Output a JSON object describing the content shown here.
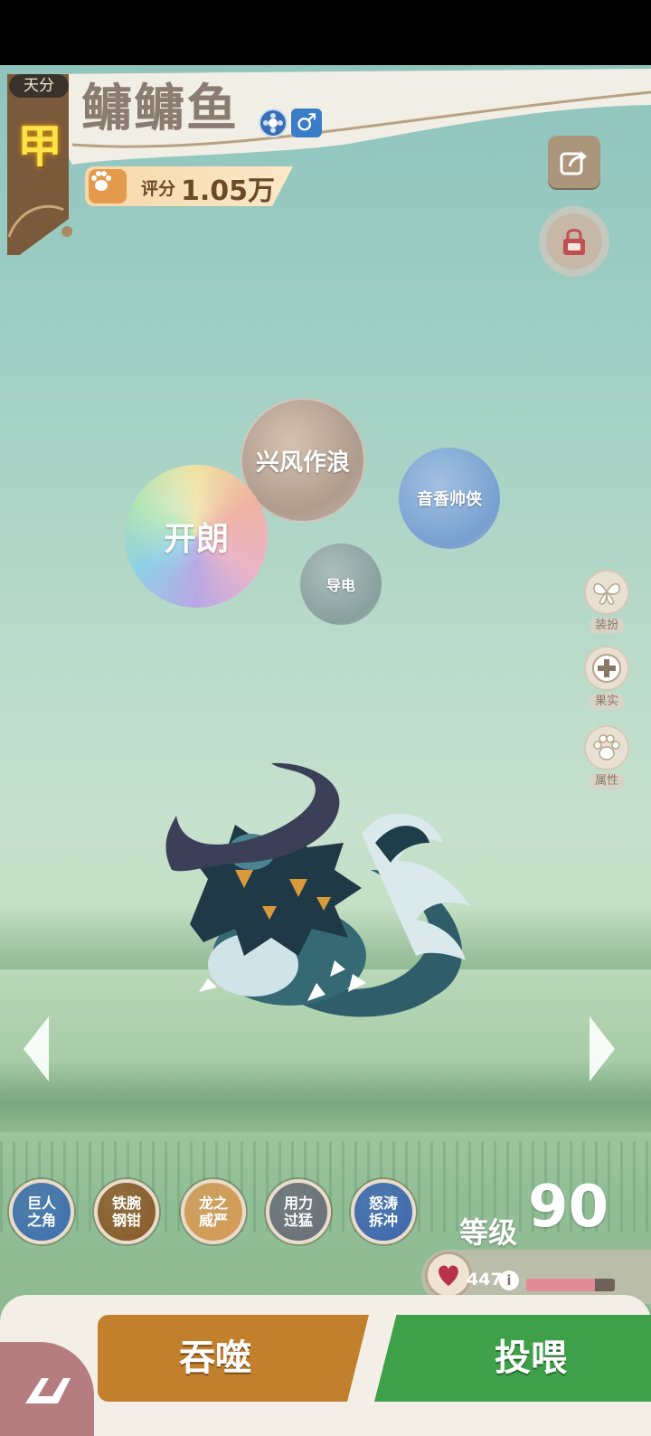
{
  "header": {
    "talent_label": "天分",
    "talent_grade": "甲",
    "pet_name": "鳙鳙鱼",
    "gender_symbol": "♂",
    "score_label": "评分",
    "score_value": "1.05万"
  },
  "top_actions": {
    "share_icon": "share-icon",
    "lock_icon": "lock-icon"
  },
  "traits": [
    {
      "label": "兴风作浪"
    },
    {
      "label": "开朗"
    },
    {
      "label": "音香帅侠"
    },
    {
      "label": "导电"
    }
  ],
  "side_menu": [
    {
      "label": "装扮",
      "icon": "butterfly-icon"
    },
    {
      "label": "果实",
      "icon": "plus-icon"
    },
    {
      "label": "属性",
      "icon": "paw-icon"
    }
  ],
  "skills": [
    {
      "label": "巨人之角",
      "color": "#3f6fae"
    },
    {
      "label": "铁腕钢钳",
      "color": "#8c5a2a"
    },
    {
      "label": "龙之威严",
      "color": "#d89a55"
    },
    {
      "label": "用力过猛",
      "color": "#6a6e78"
    },
    {
      "label": "怒涛拆冲",
      "color": "#3d67b0"
    }
  ],
  "level": {
    "label": "等级",
    "value": "90"
  },
  "health": {
    "value": "447",
    "info_symbol": "i",
    "bar_fraction": 0.78,
    "bar_color": "#e28a9a"
  },
  "actions": {
    "devour_label": "吞噬",
    "feed_label": "投喂"
  },
  "colors": {
    "devour": "#c27f2c",
    "feed": "#3fa04a",
    "grade_gold": "#ffe34a"
  }
}
